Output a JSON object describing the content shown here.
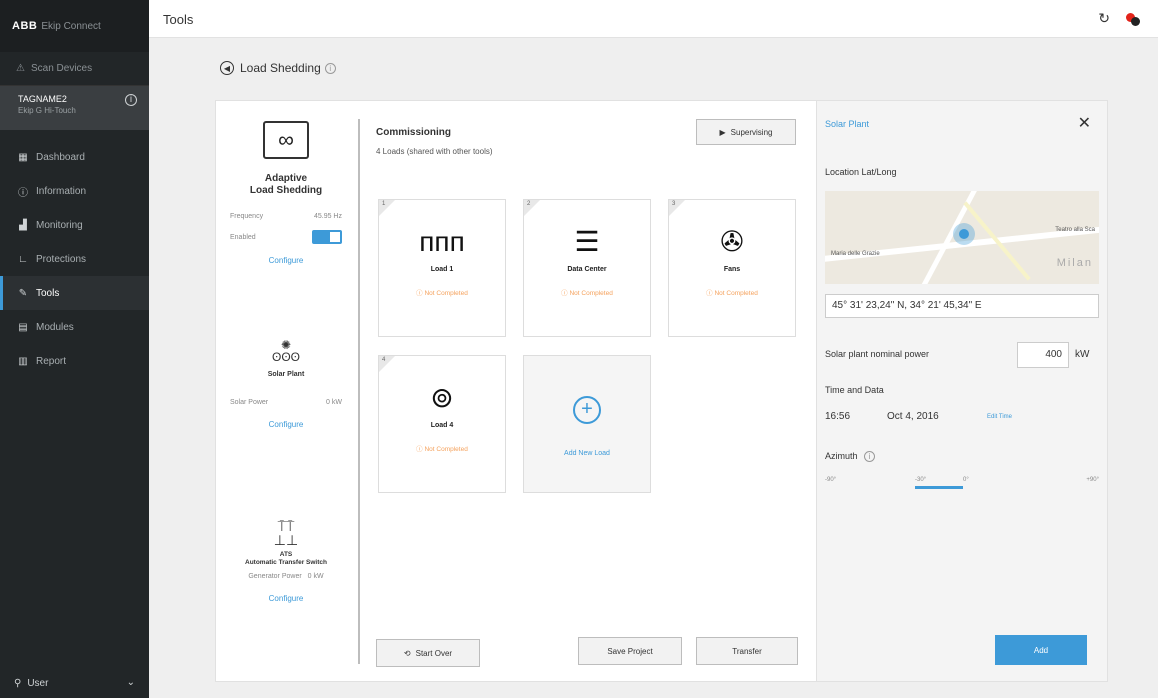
{
  "app": {
    "brand": "ABB",
    "name": "Ekip Connect"
  },
  "sidebar": {
    "scan": "Scan Devices",
    "device": {
      "name": "TAGNAME2",
      "model": "Ekip G Hi-Touch"
    },
    "items": [
      {
        "label": "Dashboard",
        "icon": "dashboard-icon"
      },
      {
        "label": "Information",
        "icon": "info-icon"
      },
      {
        "label": "Monitoring",
        "icon": "chart-icon"
      },
      {
        "label": "Protections",
        "icon": "protection-icon"
      },
      {
        "label": "Tools",
        "icon": "wrench-icon",
        "active": true
      },
      {
        "label": "Modules",
        "icon": "module-icon"
      },
      {
        "label": "Report",
        "icon": "report-icon"
      }
    ],
    "user": "User"
  },
  "topbar": {
    "title": "Tools"
  },
  "page": {
    "heading": "Load Shedding"
  },
  "tools": {
    "als": {
      "title1": "Adaptive",
      "title2": "Load Shedding",
      "freq_label": "Frequency",
      "freq_value": "45.95 Hz",
      "enabled_label": "Enabled",
      "enabled": true,
      "configure": "Configure"
    },
    "solar": {
      "title": "Solar Plant",
      "power_label": "Solar Power",
      "power_value": "0 kW",
      "configure": "Configure"
    },
    "ats": {
      "title1": "ATS",
      "title2": "Automatic Transfer Switch",
      "gen_label": "Generator Power",
      "gen_value": "0 kW",
      "configure": "Configure"
    }
  },
  "content": {
    "title": "Commissioning",
    "subtitle": "4 Loads (shared with other tools)",
    "supervising": "Supervising",
    "loads": [
      {
        "num": "1",
        "name": "Load 1",
        "status": "Not Completed",
        "icon": "radiator-icon"
      },
      {
        "num": "2",
        "name": "Data Center",
        "status": "Not Completed",
        "icon": "server-icon"
      },
      {
        "num": "3",
        "name": "Fans",
        "status": "Not Completed",
        "icon": "fan-icon"
      },
      {
        "num": "4",
        "name": "Load 4",
        "status": "Not Completed",
        "icon": "washing-machine-icon"
      }
    ],
    "add_load": "Add New Load",
    "start_over": "Start Over",
    "save_project": "Save Project",
    "transfer": "Transfer"
  },
  "panel": {
    "title": "Solar Plant",
    "location_label": "Location Lat/Long",
    "map_labels": {
      "street1": "Maria delle Grazie",
      "street2": "Teatro alla Sca",
      "city": "Milan"
    },
    "coordinates": "45° 31' 23,24\" N, 34° 21' 45,34\" E",
    "power_label": "Solar plant nominal power",
    "power_value": "400",
    "power_unit": "kW",
    "time_label": "Time and Data",
    "time": "16:56",
    "date": "Oct 4, 2016",
    "edit_time": "Edit Time",
    "azimuth_label": "Azimuth",
    "azimuth_ticks": [
      "-90°",
      "-30°",
      "0°",
      "+90°"
    ],
    "add": "Add"
  },
  "colors": {
    "accent": "#3d9ad8",
    "sidebar": "#222628",
    "warning": "#f5a25d"
  }
}
